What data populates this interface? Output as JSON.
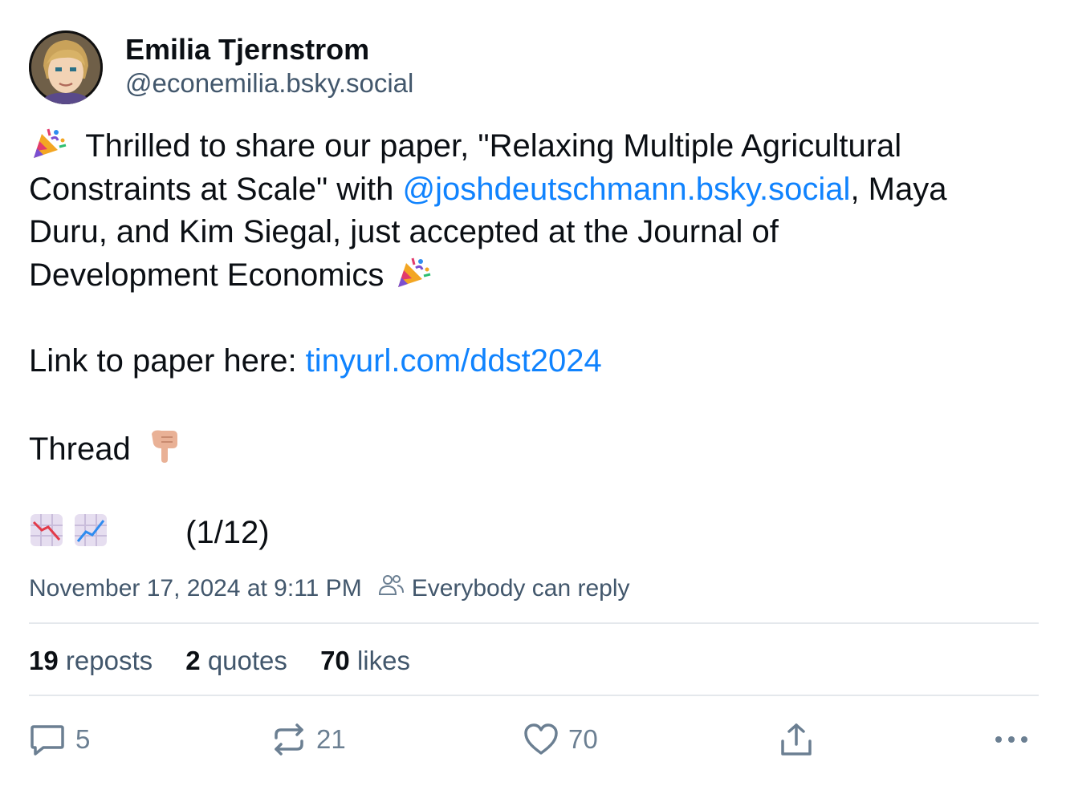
{
  "author": {
    "display_name": "Emilia Tjernstrom",
    "handle": "@econemilia.bsky.social",
    "avatar_icon": "avatar-icon"
  },
  "post": {
    "line1_text": "Thrilled to share our paper, \"Relaxing Multiple Agricultural",
    "line2_prefix": "Constraints at Scale\" with ",
    "mention": "@joshdeutschmann.bsky.social",
    "line2_suffix": ", Maya",
    "line3_text": "Duru, and Kim Siegal, just accepted at the Journal of",
    "line4_text": "Development Economics",
    "link_prefix": "Link to paper here: ",
    "link_text": "tinyurl.com/ddst2024",
    "thread_text": "Thread",
    "thread_count": "(1/12)",
    "emoji_icons": [
      "party-popper-icon",
      "pointing-down-icon",
      "chart-decreasing-icon",
      "chart-increasing-icon"
    ]
  },
  "meta": {
    "timestamp": "November 17, 2024 at 9:11 PM",
    "reply_setting": "Everybody can reply"
  },
  "stats": {
    "reposts_count": "19",
    "reposts_label": "reposts",
    "quotes_count": "2",
    "quotes_label": "quotes",
    "likes_count": "70",
    "likes_label": "likes"
  },
  "actions": {
    "reply_count": "5",
    "repost_count": "21",
    "like_count": "70"
  },
  "colors": {
    "link": "#1083fe",
    "muted": "#42576c",
    "icon": "#6b7f92",
    "divider": "#e4e8ec"
  }
}
